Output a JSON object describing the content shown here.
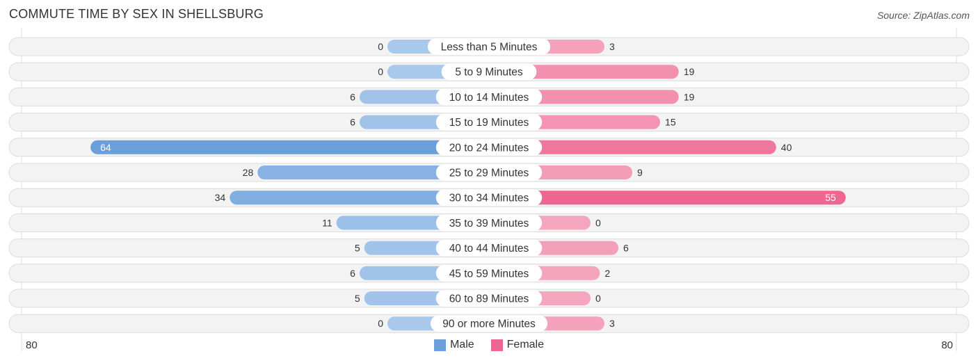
{
  "header": {
    "title": "COMMUTE TIME BY SEX IN SHELLSBURG",
    "source": "Source: ZipAtlas.com"
  },
  "legend": {
    "male_label": "Male",
    "female_label": "Female"
  },
  "axis": {
    "left_label": "80",
    "right_label": "80"
  },
  "colors": {
    "male_light": "#a8c8ec",
    "male_dark": "#6a9fdb",
    "female_light": "#f5a6bf",
    "female_dark": "#f06692",
    "track": "#f3f3f3"
  },
  "chart_data": {
    "type": "bar",
    "orientation": "horizontal-diverging",
    "title": "COMMUTE TIME BY SEX IN SHELLSBURG",
    "xlim": [
      -80,
      80
    ],
    "xlabel": "",
    "ylabel": "",
    "legend_position": "bottom-center",
    "categories": [
      "Less than 5 Minutes",
      "5 to 9 Minutes",
      "10 to 14 Minutes",
      "15 to 19 Minutes",
      "20 to 24 Minutes",
      "25 to 29 Minutes",
      "30 to 34 Minutes",
      "35 to 39 Minutes",
      "40 to 44 Minutes",
      "45 to 59 Minutes",
      "60 to 89 Minutes",
      "90 or more Minutes"
    ],
    "series": [
      {
        "name": "Male",
        "side": "left",
        "values": [
          0,
          0,
          6,
          6,
          64,
          28,
          34,
          11,
          5,
          6,
          5,
          0
        ]
      },
      {
        "name": "Female",
        "side": "right",
        "values": [
          3,
          19,
          19,
          15,
          40,
          9,
          55,
          0,
          6,
          2,
          0,
          3
        ]
      }
    ]
  }
}
